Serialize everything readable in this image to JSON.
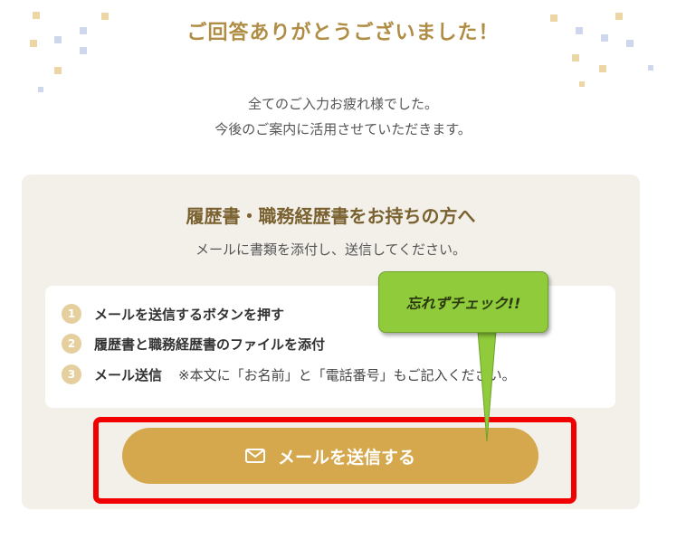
{
  "header": {
    "title": "ご回答ありがとうございました！",
    "message_line1": "全てのご入力お疲れ様でした。",
    "message_line2": "今後のご案内に活用させていただきます。"
  },
  "card": {
    "title": "履歴書・職務経歴書をお持ちの方へ",
    "subtitle": "メールに書類を添付し、送信してください。",
    "steps": [
      {
        "num": "1",
        "text": "メールを送信するボタンを押す"
      },
      {
        "num": "2",
        "text": "履歴書と職務経歴書のファイルを添付"
      },
      {
        "num": "3",
        "text": "メール送信",
        "note": "※本文に「お名前」と「電話番号」もご記入ください。"
      }
    ],
    "send_button_label": "メールを送信する",
    "send_button_icon": "mail-icon"
  },
  "annotation": {
    "callout_text": "忘れずチェック!!",
    "highlight_color": "#f20000",
    "callout_color": "#8fcb3b"
  },
  "colors": {
    "accent": "#d6a84d",
    "title": "#b08d45",
    "card_bg": "#f3f0ea"
  }
}
